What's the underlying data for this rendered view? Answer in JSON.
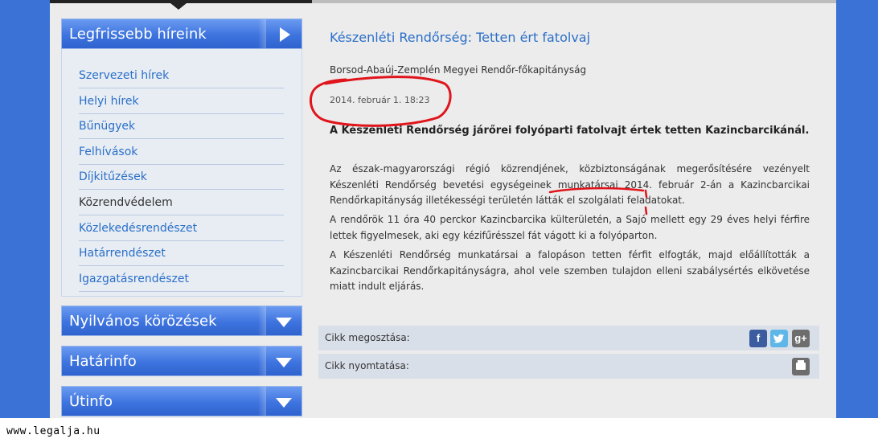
{
  "sidebar": {
    "latest_header": "Legfrissebb híreink",
    "items": [
      {
        "label": "Szervezeti hírek"
      },
      {
        "label": "Helyi hírek"
      },
      {
        "label": "Bűnügyek"
      },
      {
        "label": "Felhívások"
      },
      {
        "label": "Díjkitűzések"
      },
      {
        "label": "Közrendvédelem"
      },
      {
        "label": "Közlekedésrendészet"
      },
      {
        "label": "Határrendészet"
      },
      {
        "label": "Igazgatásrendészet"
      }
    ],
    "wanted_header": "Nyilvános körözések",
    "border_header": "Határinfo",
    "road_header": "Útinfo"
  },
  "article": {
    "title": "Készenléti Rendőrség: Tetten ért fatolvaj",
    "source": "Borsod-Abaúj-Zemplén Megyei Rendőr-főkapitányság",
    "date": "2014. február 1. 18:23",
    "lead": "A Készenléti Rendőrség járőrei folyóparti fatolvajt értek tetten Kazincbarcikánál.",
    "p1": "Az észak-magyarországi régió közrendjének, közbiztonságának megerősítésére vezényelt Készenléti Rendőrség bevetési egységeinek munkatársai 2014. február 2-án a Kazincbarcikai Rendőrkapitányság illetékességi területén látták el szolgálati feladatokat.",
    "p2": "A rendőrök 11 óra 40 perckor Kazincbarcika külterületén, a Sajó mellett egy 29 éves helyi férfire lettek figyelmesek, aki egy kézifűrésszel fát vágott ki a folyóparton.",
    "p3": "A Készenléti Rendőrség munkatársai a falopáson tetten férfit elfogták, majd előállították a Kazincbarcikai Rendőrkapitányságra, ahol vele szemben tulajdon elleni szabálysértés elkövetése miatt indult eljárás."
  },
  "share": {
    "share_label": "Cikk megosztása:",
    "print_label": "Cikk nyomtatása:",
    "facebook_glyph": "f",
    "googleplus_glyph": "g+"
  },
  "watermark": "www.legalja.hu",
  "colors": {
    "brand_blue": "#3a72d6",
    "link_blue": "#2a6fc8",
    "annotation_red": "#e0141b"
  }
}
